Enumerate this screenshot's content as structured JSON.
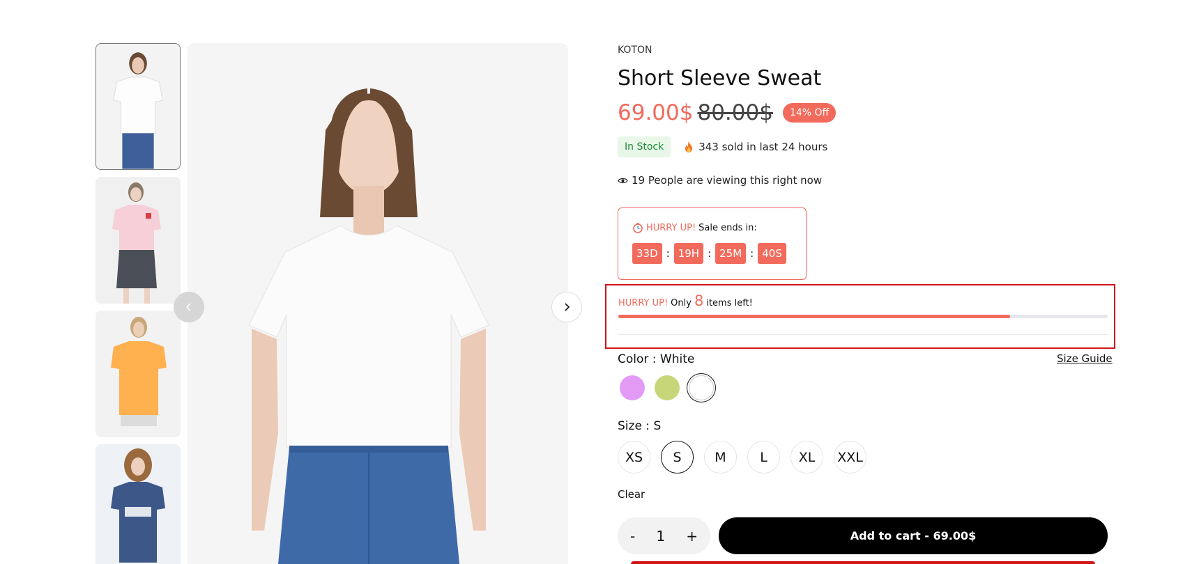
{
  "product": {
    "brand": "KOTON",
    "title": "Short Sleeve Sweat",
    "price_now": "69.00$",
    "price_old": "80.00$",
    "discount": "14% Off",
    "stock_status": "In Stock",
    "sold_text": "343 sold in last 24 hours",
    "viewing_text": "19 People are viewing this right now"
  },
  "sale": {
    "hurry": "HURRY UP!",
    "ends": "Sale ends in:",
    "days": "33D",
    "hours": "19H",
    "minutes": "25M",
    "seconds": "40S",
    "colon": ":"
  },
  "stock_alert": {
    "hurry": "HURRY UP!",
    "only": "Only",
    "count": "8",
    "items_left": "items left!",
    "progress_fraction": 0.8
  },
  "color": {
    "label": "Color :",
    "selected": "White",
    "size_guide": "Size Guide",
    "swatches": [
      "#e39af5",
      "#c8d67a",
      "#ffffff"
    ]
  },
  "size": {
    "label": "Size :",
    "selected": "S",
    "options": [
      "XS",
      "S",
      "M",
      "L",
      "XL",
      "XXL"
    ],
    "clear": "Clear"
  },
  "cart": {
    "minus": "-",
    "qty": "1",
    "plus": "+",
    "add_label": "Add to cart - 69.00$"
  },
  "colors": {
    "accent": "#f26a5c",
    "highlight_border": "#d1141a",
    "in_stock_bg": "#e8f7e8",
    "in_stock_text": "#1f8a3a"
  },
  "icons": {
    "prev": "chevron-left-icon",
    "next": "chevron-right-icon",
    "fire": "fire-icon",
    "eye": "eye-icon",
    "clock": "stopwatch-icon"
  }
}
